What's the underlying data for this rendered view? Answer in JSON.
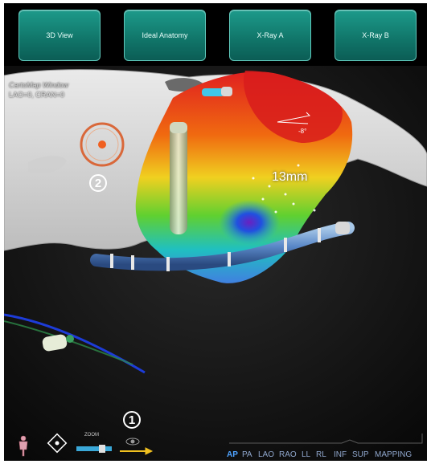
{
  "top_buttons": [
    {
      "label": "3D View"
    },
    {
      "label": "Ideal Anatomy"
    },
    {
      "label": "X-Ray A"
    },
    {
      "label": "X-Ray B"
    }
  ],
  "view_overlay": {
    "window_name": "CartoMap Window",
    "angles": "LAO=0, CRAN=0"
  },
  "measurement": {
    "label": "13mm"
  },
  "angle_marker": {
    "label": "-8°"
  },
  "callouts": [
    {
      "label": "2"
    },
    {
      "label": "1"
    }
  ],
  "bottom_toolbar": {
    "zoom_label": "ZOOM",
    "icons": [
      "body-figure-icon",
      "navigation-pad-icon",
      "zoom-slider-icon",
      "eye-icon",
      "arrow-right-icon"
    ]
  },
  "view_tabs": [
    {
      "label": "AP",
      "active": true
    },
    {
      "label": "PA",
      "active": false
    },
    {
      "label": "LAO",
      "active": false
    },
    {
      "label": "RAO",
      "active": false
    },
    {
      "label": "LL",
      "active": false
    },
    {
      "label": "RL",
      "active": false
    },
    {
      "label": "INF",
      "active": false
    },
    {
      "label": "SUP",
      "active": false
    },
    {
      "label": "MAPPING",
      "active": false
    }
  ],
  "colors": {
    "button_teal": "#138070",
    "accent_orange": "#d9683a",
    "active_tab": "#4fa3ff",
    "tab_text": "#8fa6cc",
    "arrow_yellow": "#f0c020"
  }
}
